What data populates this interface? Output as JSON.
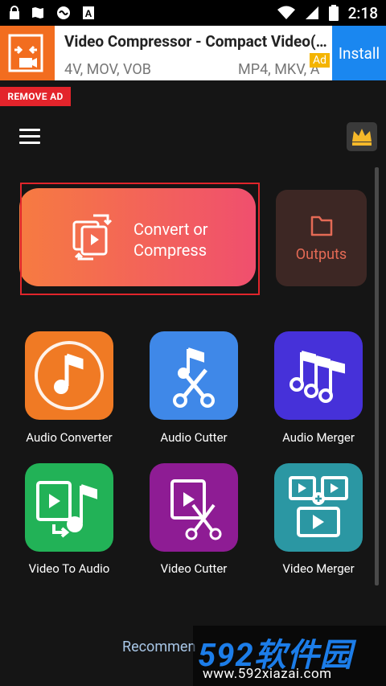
{
  "status_bar": {
    "time": "2:18"
  },
  "ad": {
    "title": "Video Compressor - Compact Video(…",
    "subtitle_left": "4V, MOV, VOB",
    "subtitle_right": "MP4, MKV, A",
    "badge": "Ad",
    "install_label": "Install"
  },
  "remove_ad_label": "REMOVE AD",
  "main": {
    "convert_label_line1": "Convert or",
    "convert_label_line2": "Compress",
    "outputs_label": "Outputs"
  },
  "tools": [
    {
      "label": "Audio Converter",
      "color": "#f07a24"
    },
    {
      "label": "Audio Cutter",
      "color": "#3f88e8"
    },
    {
      "label": "Audio Merger",
      "color": "#4631d9"
    },
    {
      "label": "Video To Audio",
      "color": "#22b257"
    },
    {
      "label": "Video Cutter",
      "color": "#8e1c94"
    },
    {
      "label": "Video Merger",
      "color": "#2b97a3"
    }
  ],
  "recommend_label": "Recommen",
  "watermark": {
    "big": "592软件园",
    "small": "www.592xiazai.com"
  },
  "colors": {
    "accent": "#f04f6e",
    "highlight_frame": "#e0252b",
    "install": "#1a87f0"
  }
}
